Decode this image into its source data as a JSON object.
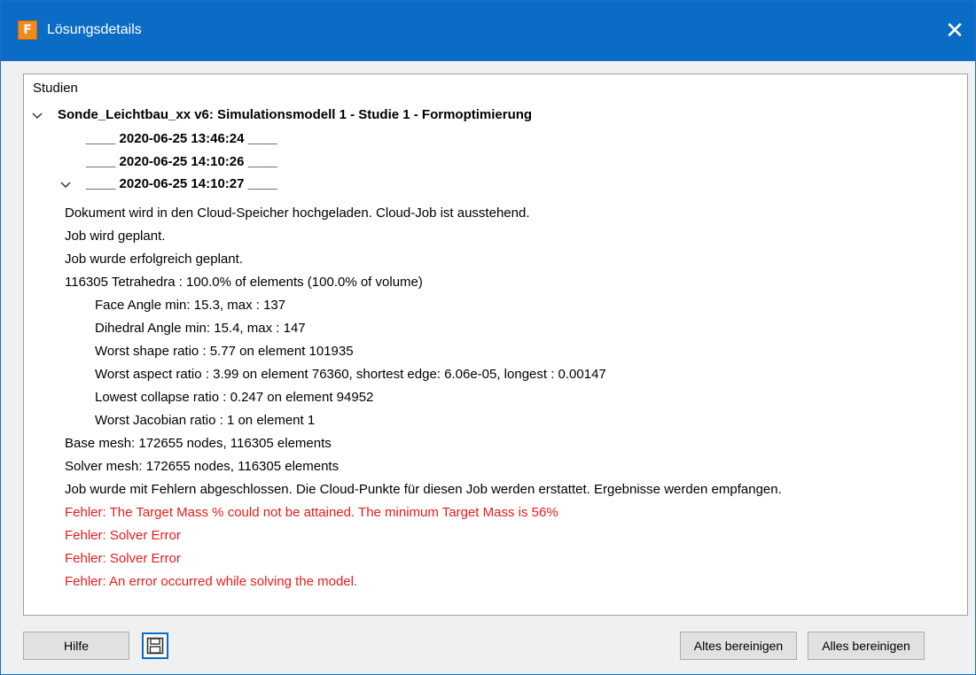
{
  "window": {
    "title": "Lösungsdetails",
    "icon_letter": "F",
    "close_glyph": "✕",
    "accent_color": "#0b6cc6"
  },
  "log": {
    "root_label": "Studien",
    "study_label": "Sonde_Leichtbau_xx v6: Simulationsmodell 1 - Studie 1 - Formoptimierung",
    "runs": [
      "____ 2020-06-25 13:46:24 ____",
      "____ 2020-06-25 14:10:26 ____",
      "____ 2020-06-25 14:10:27 ____"
    ],
    "messages": [
      "Dokument wird in den Cloud-Speicher hochgeladen. Cloud-Job ist ausstehend.",
      "Job wird geplant.",
      "Job wurde erfolgreich geplant.",
      "116305 Tetrahedra :  100.0% of elements (100.0% of volume)",
      "Face Angle min:  15.3,  max : 137",
      "Dihedral Angle min:  15.4,  max : 147",
      "Worst shape ratio :  5.77  on element 101935",
      "Worst aspect ratio :  3.99  on element 76360, shortest edge: 6.06e-05, longest : 0.00147",
      "Lowest collapse ratio :  0.247  on element 94952",
      "Worst Jacobian ratio :  1  on element 1",
      "Base mesh: 172655 nodes, 116305 elements",
      "Solver mesh: 172655 nodes, 116305 elements",
      "Job wurde mit Fehlern abgeschlossen. Die Cloud-Punkte für diesen Job werden erstattet. Ergebnisse werden empfangen."
    ],
    "errors": [
      "Fehler: The Target Mass % could not be attained. The minimum Target Mass is 56%",
      "Fehler: Solver Error",
      "Fehler: Solver Error",
      "Fehler: An error occurred while solving the model."
    ],
    "error_color": "#e81c1c"
  },
  "footer": {
    "help_label": "Hilfe",
    "save_icon": "save-icon",
    "clear_old_label": "Altes bereinigen",
    "clear_all_label": "Alles bereinigen"
  }
}
